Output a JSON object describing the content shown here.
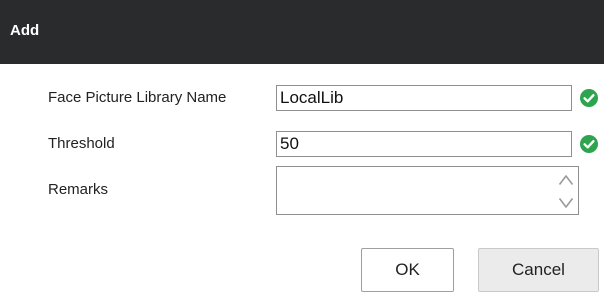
{
  "dialog": {
    "title": "Add"
  },
  "form": {
    "library_name": {
      "label": "Face Picture Library Name",
      "value": "LocalLib",
      "valid": true
    },
    "threshold": {
      "label": "Threshold",
      "value": "50",
      "valid": true
    },
    "remarks": {
      "label": "Remarks",
      "value": ""
    }
  },
  "buttons": {
    "ok_label": "OK",
    "cancel_label": "Cancel"
  },
  "icons": {
    "valid": "check-circle-icon",
    "scroll_up": "scroll-up-arrow-icon",
    "scroll_down": "scroll-down-arrow-icon"
  },
  "colors": {
    "titlebar": "#2a2b2d",
    "valid_green": "#2ea44f",
    "cancel_bg": "#ebebeb"
  }
}
